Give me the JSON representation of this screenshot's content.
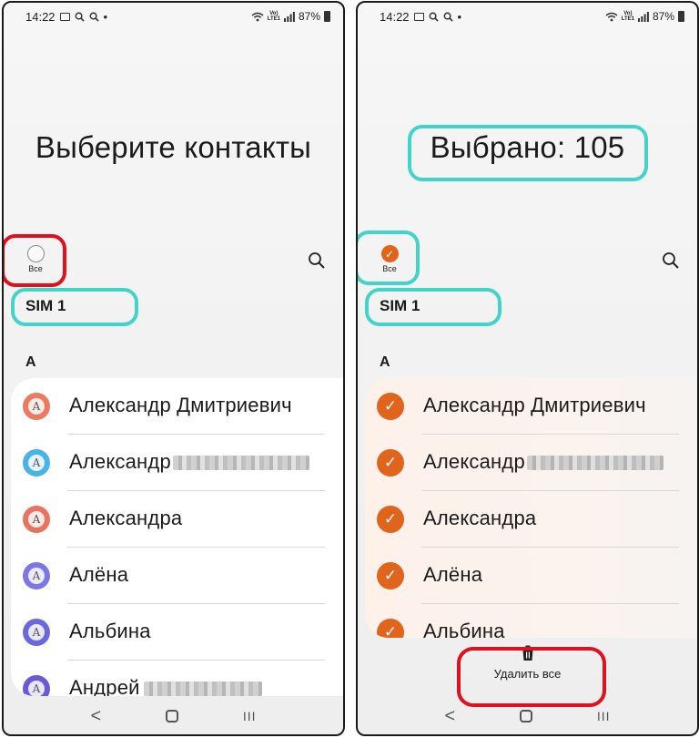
{
  "left_screen": {
    "status": {
      "time": "14:22",
      "battery": "87%",
      "dot": "•",
      "volte": [
        "Vo)",
        "LTE1"
      ]
    },
    "title": "Выберите контакты",
    "select_all_label": "Все",
    "sim_label": "SIM 1",
    "section_letter": "А",
    "contacts": [
      {
        "name": "Александр Дмитриевич",
        "avatar_letter": "A",
        "avatar_color": "#ec7a5e"
      },
      {
        "name": "Александр",
        "avatar_letter": "A",
        "avatar_color": "#49b3e8",
        "blurred_surname": true
      },
      {
        "name": "Александра",
        "avatar_letter": "A",
        "avatar_color": "#e8735f"
      },
      {
        "name": "Алёна",
        "avatar_letter": "A",
        "avatar_color": "#7a78e6"
      },
      {
        "name": "Альбина",
        "avatar_letter": "A",
        "avatar_color": "#6a67df"
      },
      {
        "name": "Андрей",
        "avatar_letter": "A",
        "avatar_color": "#6a5ad6",
        "blurred_surname": true
      }
    ]
  },
  "right_screen": {
    "status": {
      "time": "14:22",
      "battery": "87%",
      "dot": "•",
      "volte": [
        "Vo)",
        "LTE1"
      ]
    },
    "title": "Выбрано: 105",
    "select_all_label": "Все",
    "sim_label": "SIM 1",
    "section_letter": "А",
    "contacts": [
      {
        "name": "Александр Дмитриевич",
        "checked": true
      },
      {
        "name": "Александр",
        "checked": true,
        "blurred_surname": true
      },
      {
        "name": "Александра",
        "checked": true
      },
      {
        "name": "Алёна",
        "checked": true
      },
      {
        "name": "Альбина",
        "checked": true
      }
    ],
    "delete_all_label": "Удалить все"
  },
  "nav": {
    "back": "<",
    "recents": "III"
  },
  "colors": {
    "accent": "#e0641c",
    "highlight_red": "#e0101e",
    "highlight_cyan": "#42d4c9"
  },
  "icons": [
    "search-icon",
    "gallery-icon",
    "wifi-icon",
    "signal-icon",
    "battery-icon",
    "trash-icon",
    "checkmark-icon",
    "home-icon",
    "back-icon",
    "recents-icon"
  ]
}
